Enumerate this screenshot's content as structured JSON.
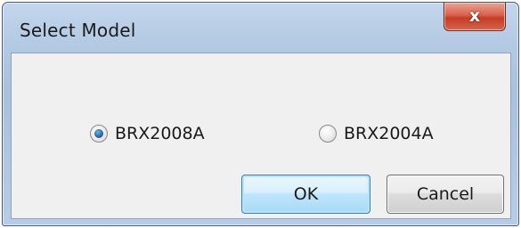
{
  "window": {
    "title": "Select Model",
    "close_glyph": "x"
  },
  "radios": [
    {
      "label": "BRX2008A",
      "checked": true
    },
    {
      "label": "BRX2004A",
      "checked": false
    }
  ],
  "buttons": {
    "ok_label": "OK",
    "cancel_label": "Cancel"
  },
  "colors": {
    "titlebar": "#b4cae3",
    "close_button": "#c63c25",
    "client_background": "#f0f0f0",
    "ok_border": "#3c7fb1",
    "radio_selected": "#2a6fb0"
  }
}
